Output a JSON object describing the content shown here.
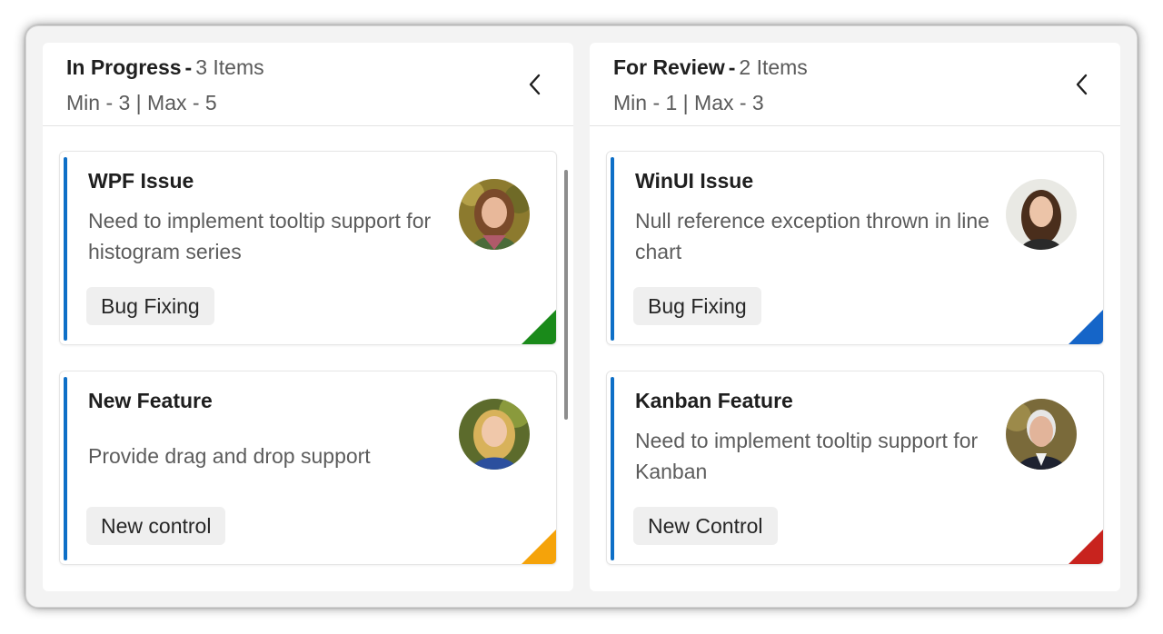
{
  "columns": [
    {
      "title": "In Progress",
      "separator": "-",
      "count_label": "3 Items",
      "limits": "Min - 3 | Max - 5",
      "cards": [
        {
          "title": "WPF Issue",
          "description": "Need to implement tooltip support for histogram series",
          "tag": "Bug Fixing",
          "priority_color": "#1a8a1a",
          "avatar": "woman-portrait-avatar"
        },
        {
          "title": "New Feature",
          "description": "Provide drag and drop support",
          "tag": "New control",
          "priority_color": "#f5a30a",
          "avatar": "woman-portrait-avatar"
        }
      ]
    },
    {
      "title": "For Review",
      "separator": "-",
      "count_label": "2 Items",
      "limits": "Min - 1 | Max - 3",
      "cards": [
        {
          "title": "WinUI Issue",
          "description": "Null reference exception thrown in line chart",
          "tag": "Bug Fixing",
          "priority_color": "#1565c8",
          "avatar": "woman-portrait-avatar"
        },
        {
          "title": "Kanban Feature",
          "description": "Need to implement tooltip support for Kanban",
          "tag": "New Control",
          "priority_color": "#c8231e",
          "avatar": "man-portrait-avatar"
        }
      ]
    }
  ],
  "colors": {
    "card_accent": "#0e6fc7",
    "background": "#f3f3f3"
  },
  "icons": {
    "collapse": "chevron-left-icon"
  }
}
